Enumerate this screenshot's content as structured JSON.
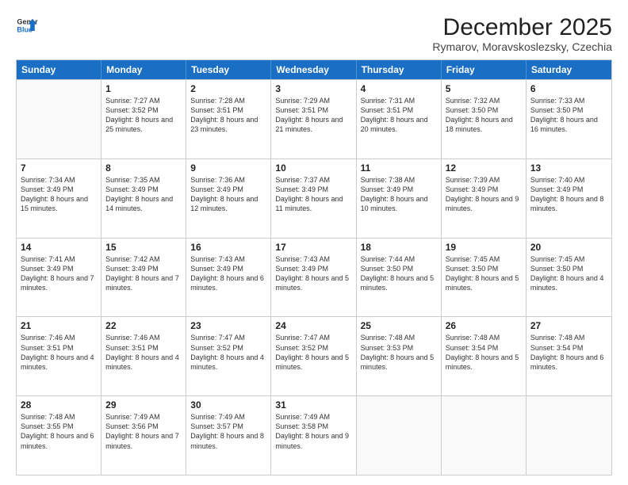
{
  "logo": {
    "line1": "General",
    "line2": "Blue"
  },
  "title": "December 2025",
  "subtitle": "Rymarov, Moravskoslezsky, Czechia",
  "days_of_week": [
    "Sunday",
    "Monday",
    "Tuesday",
    "Wednesday",
    "Thursday",
    "Friday",
    "Saturday"
  ],
  "weeks": [
    [
      {
        "day": "",
        "empty": true
      },
      {
        "day": "1",
        "rise": "7:27 AM",
        "set": "3:52 PM",
        "daylight": "8 hours and 25 minutes."
      },
      {
        "day": "2",
        "rise": "7:28 AM",
        "set": "3:51 PM",
        "daylight": "8 hours and 23 minutes."
      },
      {
        "day": "3",
        "rise": "7:29 AM",
        "set": "3:51 PM",
        "daylight": "8 hours and 21 minutes."
      },
      {
        "day": "4",
        "rise": "7:31 AM",
        "set": "3:51 PM",
        "daylight": "8 hours and 20 minutes."
      },
      {
        "day": "5",
        "rise": "7:32 AM",
        "set": "3:50 PM",
        "daylight": "8 hours and 18 minutes."
      },
      {
        "day": "6",
        "rise": "7:33 AM",
        "set": "3:50 PM",
        "daylight": "8 hours and 16 minutes."
      }
    ],
    [
      {
        "day": "7",
        "rise": "7:34 AM",
        "set": "3:49 PM",
        "daylight": "8 hours and 15 minutes."
      },
      {
        "day": "8",
        "rise": "7:35 AM",
        "set": "3:49 PM",
        "daylight": "8 hours and 14 minutes."
      },
      {
        "day": "9",
        "rise": "7:36 AM",
        "set": "3:49 PM",
        "daylight": "8 hours and 12 minutes."
      },
      {
        "day": "10",
        "rise": "7:37 AM",
        "set": "3:49 PM",
        "daylight": "8 hours and 11 minutes."
      },
      {
        "day": "11",
        "rise": "7:38 AM",
        "set": "3:49 PM",
        "daylight": "8 hours and 10 minutes."
      },
      {
        "day": "12",
        "rise": "7:39 AM",
        "set": "3:49 PM",
        "daylight": "8 hours and 9 minutes."
      },
      {
        "day": "13",
        "rise": "7:40 AM",
        "set": "3:49 PM",
        "daylight": "8 hours and 8 minutes."
      }
    ],
    [
      {
        "day": "14",
        "rise": "7:41 AM",
        "set": "3:49 PM",
        "daylight": "8 hours and 7 minutes."
      },
      {
        "day": "15",
        "rise": "7:42 AM",
        "set": "3:49 PM",
        "daylight": "8 hours and 7 minutes."
      },
      {
        "day": "16",
        "rise": "7:43 AM",
        "set": "3:49 PM",
        "daylight": "8 hours and 6 minutes."
      },
      {
        "day": "17",
        "rise": "7:43 AM",
        "set": "3:49 PM",
        "daylight": "8 hours and 5 minutes."
      },
      {
        "day": "18",
        "rise": "7:44 AM",
        "set": "3:50 PM",
        "daylight": "8 hours and 5 minutes."
      },
      {
        "day": "19",
        "rise": "7:45 AM",
        "set": "3:50 PM",
        "daylight": "8 hours and 5 minutes."
      },
      {
        "day": "20",
        "rise": "7:45 AM",
        "set": "3:50 PM",
        "daylight": "8 hours and 4 minutes."
      }
    ],
    [
      {
        "day": "21",
        "rise": "7:46 AM",
        "set": "3:51 PM",
        "daylight": "8 hours and 4 minutes."
      },
      {
        "day": "22",
        "rise": "7:46 AM",
        "set": "3:51 PM",
        "daylight": "8 hours and 4 minutes."
      },
      {
        "day": "23",
        "rise": "7:47 AM",
        "set": "3:52 PM",
        "daylight": "8 hours and 4 minutes."
      },
      {
        "day": "24",
        "rise": "7:47 AM",
        "set": "3:52 PM",
        "daylight": "8 hours and 5 minutes."
      },
      {
        "day": "25",
        "rise": "7:48 AM",
        "set": "3:53 PM",
        "daylight": "8 hours and 5 minutes."
      },
      {
        "day": "26",
        "rise": "7:48 AM",
        "set": "3:54 PM",
        "daylight": "8 hours and 5 minutes."
      },
      {
        "day": "27",
        "rise": "7:48 AM",
        "set": "3:54 PM",
        "daylight": "8 hours and 6 minutes."
      }
    ],
    [
      {
        "day": "28",
        "rise": "7:48 AM",
        "set": "3:55 PM",
        "daylight": "8 hours and 6 minutes."
      },
      {
        "day": "29",
        "rise": "7:49 AM",
        "set": "3:56 PM",
        "daylight": "8 hours and 7 minutes."
      },
      {
        "day": "30",
        "rise": "7:49 AM",
        "set": "3:57 PM",
        "daylight": "8 hours and 8 minutes."
      },
      {
        "day": "31",
        "rise": "7:49 AM",
        "set": "3:58 PM",
        "daylight": "8 hours and 9 minutes."
      },
      {
        "day": "",
        "empty": true
      },
      {
        "day": "",
        "empty": true
      },
      {
        "day": "",
        "empty": true
      }
    ]
  ]
}
